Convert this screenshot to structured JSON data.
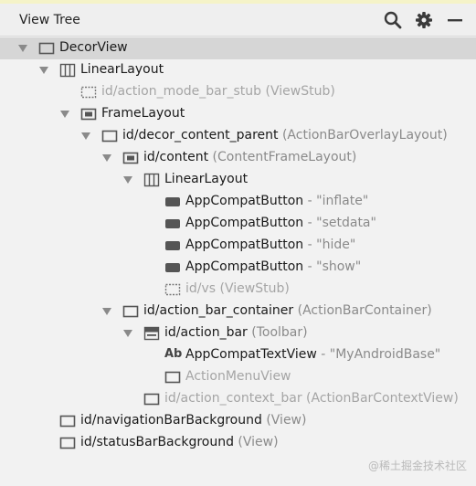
{
  "window": {
    "title": "View Tree"
  },
  "toolbar": {
    "search_icon": "search-icon",
    "settings_icon": "gear-icon",
    "minimize_icon": "minus-icon"
  },
  "tree": [
    {
      "name": "DecorView",
      "icon": "frame-icon",
      "expanded": true,
      "selected": true
    },
    {
      "name": "LinearLayout",
      "icon": "linear-layout-icon",
      "expanded": true
    },
    {
      "name": "id/action_mode_bar_stub",
      "detail": " (ViewStub)",
      "icon": "viewstub-icon",
      "disabled": true
    },
    {
      "name": "FrameLayout",
      "icon": "framelayout-icon",
      "expanded": true
    },
    {
      "name": "id/decor_content_parent",
      "detail": " (ActionBarOverlayLayout)",
      "icon": "frame-icon",
      "expanded": true
    },
    {
      "name": "id/content",
      "detail": " (ContentFrameLayout)",
      "icon": "framelayout-icon",
      "expanded": true
    },
    {
      "name": "LinearLayout",
      "icon": "linear-layout-icon",
      "expanded": true
    },
    {
      "name": "AppCompatButton",
      "detail": " - \"inflate\"",
      "icon": "button-icon"
    },
    {
      "name": "AppCompatButton",
      "detail": " - \"setdata\"",
      "icon": "button-icon"
    },
    {
      "name": "AppCompatButton",
      "detail": " - \"hide\"",
      "icon": "button-icon"
    },
    {
      "name": "AppCompatButton",
      "detail": " - \"show\"",
      "icon": "button-icon"
    },
    {
      "name": "id/vs",
      "detail": " (ViewStub)",
      "icon": "viewstub-icon",
      "disabled": true
    },
    {
      "name": "id/action_bar_container",
      "detail": " (ActionBarContainer)",
      "icon": "frame-icon",
      "expanded": true
    },
    {
      "name": "id/action_bar",
      "detail": " (Toolbar)",
      "icon": "toolbar-icon",
      "expanded": true
    },
    {
      "name": "AppCompatTextView",
      "detail": " - \"MyAndroidBase\"",
      "icon": "textview-icon",
      "icon_text": "Ab"
    },
    {
      "name": "ActionMenuView",
      "icon": "frame-icon",
      "disabled": true
    },
    {
      "name": "id/action_context_bar",
      "detail": " (ActionBarContextView)",
      "icon": "frame-icon",
      "disabled": true
    },
    {
      "name": "id/navigationBarBackground",
      "detail": " (View)",
      "icon": "frame-icon"
    },
    {
      "name": "id/statusBarBackground",
      "detail": " (View)",
      "icon": "frame-icon"
    }
  ],
  "watermark": "@稀土掘金技术社区"
}
